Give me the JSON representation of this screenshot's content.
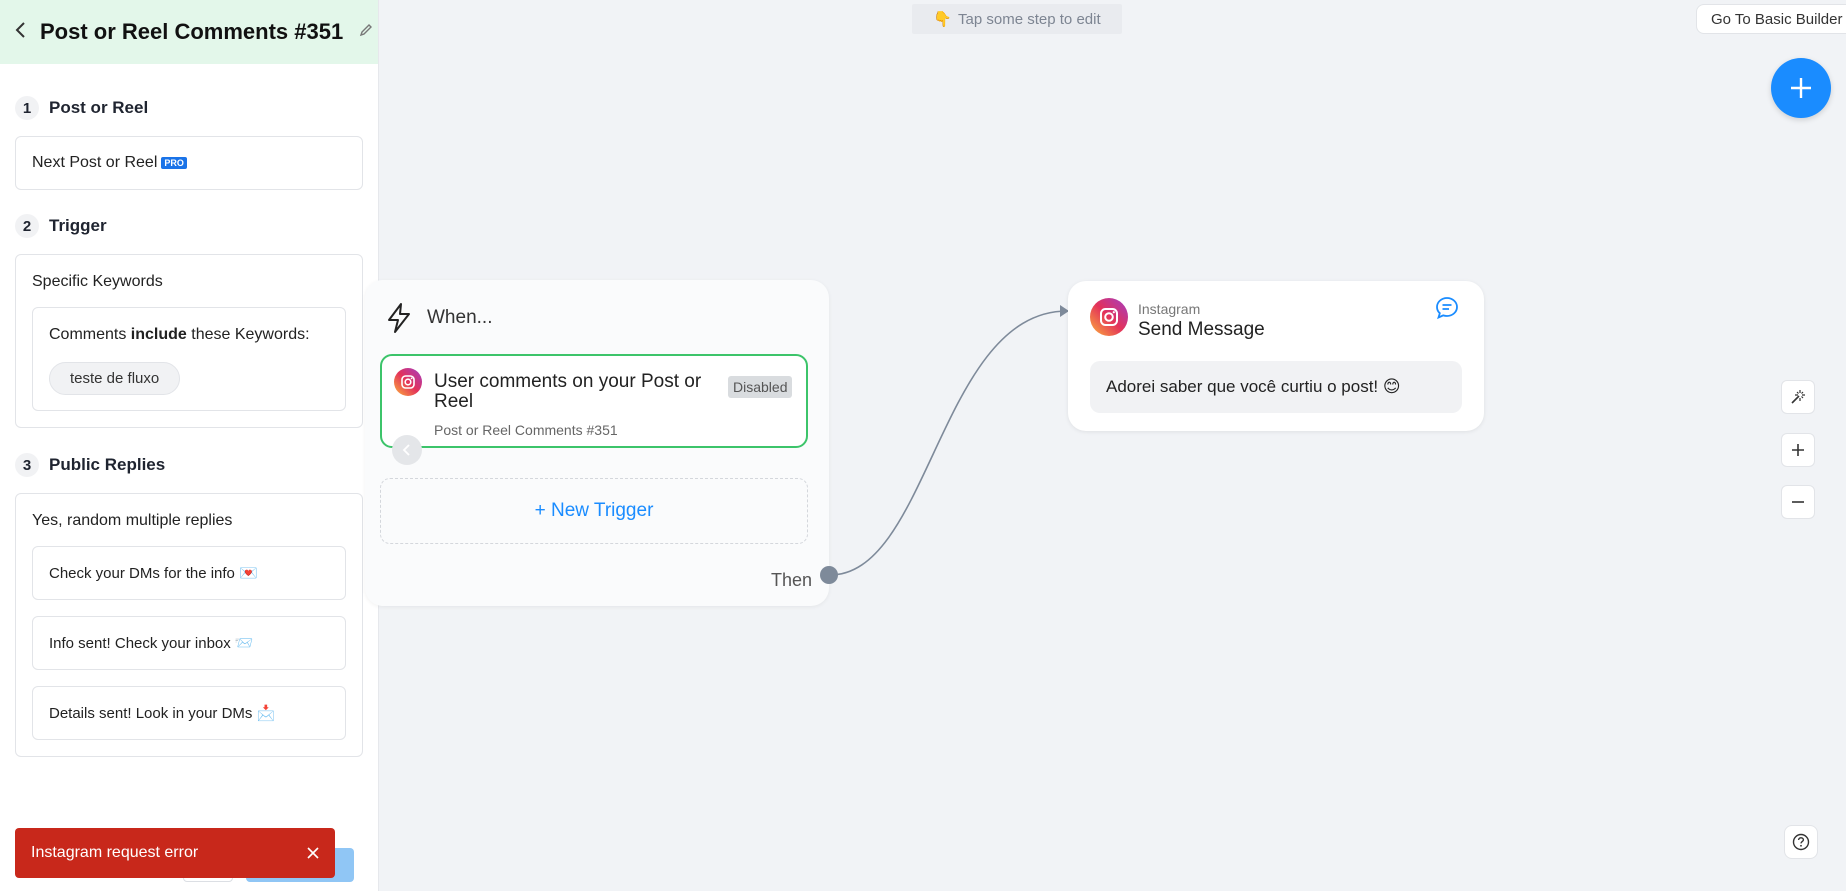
{
  "sidebar": {
    "title": "Post or Reel Comments #351",
    "sections": [
      {
        "num": "1",
        "title": "Post or Reel"
      },
      {
        "num": "2",
        "title": "Trigger"
      },
      {
        "num": "3",
        "title": "Public Replies"
      }
    ],
    "post": {
      "label": "Next Post or Reel",
      "badge": "PRO"
    },
    "trigger": {
      "type": "Specific Keywords",
      "rule_prefix": "Comments ",
      "rule_bold": "include",
      "rule_suffix": " these Keywords:",
      "keywords": [
        "teste de fluxo"
      ]
    },
    "replies": {
      "mode": "Yes, random multiple replies",
      "items": [
        "Check your DMs for the info 💌",
        "Info sent! Check your inbox 📨",
        "Details sent! Look in your DMs 📩"
      ]
    },
    "toast": {
      "message": "Instagram request error"
    }
  },
  "canvas": {
    "hint": "Tap some step to edit",
    "hint_icon": "👇",
    "basic_builder": "Go To Basic Builder",
    "when": {
      "heading": "When...",
      "trigger_title": "User comments on your Post or Reel",
      "trigger_status": "Disabled",
      "trigger_subtitle": "Post or Reel Comments #351",
      "new_trigger": "+ New Trigger",
      "then": "Then"
    },
    "message": {
      "platform": "Instagram",
      "action": "Send Message",
      "text": "Adorei saber que você curtiu o post! 😊"
    }
  },
  "colors": {
    "accent": "#1a8cff",
    "header_bg": "#e3f7ea",
    "trigger_border": "#3cc46a",
    "toast_bg": "#c8281b"
  }
}
